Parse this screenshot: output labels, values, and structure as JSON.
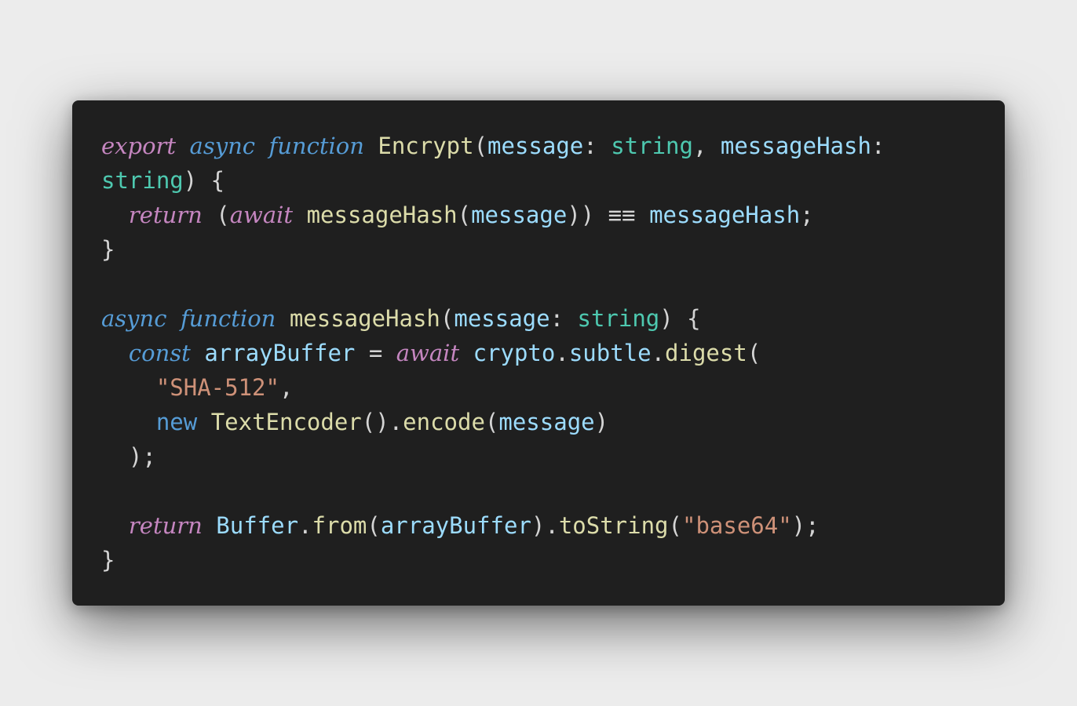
{
  "code_lines": [
    [
      {
        "t": "export",
        "c": "kw-ctrl"
      },
      {
        "t": " ",
        "c": "punc"
      },
      {
        "t": "async",
        "c": "kw-decl"
      },
      {
        "t": " ",
        "c": "punc"
      },
      {
        "t": "function",
        "c": "kw-decl"
      },
      {
        "t": " ",
        "c": "punc"
      },
      {
        "t": "Encrypt",
        "c": "fn"
      },
      {
        "t": "(",
        "c": "punc"
      },
      {
        "t": "message",
        "c": "var"
      },
      {
        "t": ": ",
        "c": "punc"
      },
      {
        "t": "string",
        "c": "type"
      },
      {
        "t": ", ",
        "c": "punc"
      },
      {
        "t": "messageHash",
        "c": "var"
      },
      {
        "t": ":",
        "c": "punc"
      }
    ],
    [
      {
        "t": "string",
        "c": "type"
      },
      {
        "t": ") {",
        "c": "punc"
      }
    ],
    [
      {
        "t": "  ",
        "c": "punc"
      },
      {
        "t": "return",
        "c": "kw-ctrl"
      },
      {
        "t": " (",
        "c": "punc"
      },
      {
        "t": "await",
        "c": "kw-ctrl"
      },
      {
        "t": " ",
        "c": "punc"
      },
      {
        "t": "messageHash",
        "c": "fn"
      },
      {
        "t": "(",
        "c": "punc"
      },
      {
        "t": "message",
        "c": "var"
      },
      {
        "t": ")) ",
        "c": "punc"
      },
      {
        "t": "≡≡",
        "c": "op"
      },
      {
        "t": " ",
        "c": "punc"
      },
      {
        "t": "messageHash",
        "c": "var"
      },
      {
        "t": ";",
        "c": "punc"
      }
    ],
    [
      {
        "t": "}",
        "c": "punc"
      }
    ],
    [],
    [
      {
        "t": "async",
        "c": "kw-decl"
      },
      {
        "t": " ",
        "c": "punc"
      },
      {
        "t": "function",
        "c": "kw-decl"
      },
      {
        "t": " ",
        "c": "punc"
      },
      {
        "t": "messageHash",
        "c": "fn"
      },
      {
        "t": "(",
        "c": "punc"
      },
      {
        "t": "message",
        "c": "var"
      },
      {
        "t": ": ",
        "c": "punc"
      },
      {
        "t": "string",
        "c": "type"
      },
      {
        "t": ") {",
        "c": "punc"
      }
    ],
    [
      {
        "t": "  ",
        "c": "punc"
      },
      {
        "t": "const",
        "c": "kw-decl"
      },
      {
        "t": " ",
        "c": "punc"
      },
      {
        "t": "arrayBuffer",
        "c": "var"
      },
      {
        "t": " = ",
        "c": "punc"
      },
      {
        "t": "await",
        "c": "kw-ctrl"
      },
      {
        "t": " ",
        "c": "punc"
      },
      {
        "t": "crypto",
        "c": "var"
      },
      {
        "t": ".",
        "c": "punc"
      },
      {
        "t": "subtle",
        "c": "var"
      },
      {
        "t": ".",
        "c": "punc"
      },
      {
        "t": "digest",
        "c": "fn"
      },
      {
        "t": "(",
        "c": "punc"
      }
    ],
    [
      {
        "t": "    ",
        "c": "punc"
      },
      {
        "t": "\"SHA-512\"",
        "c": "str"
      },
      {
        "t": ",",
        "c": "punc"
      }
    ],
    [
      {
        "t": "    ",
        "c": "punc"
      },
      {
        "t": "new",
        "c": "kw-new"
      },
      {
        "t": " ",
        "c": "punc"
      },
      {
        "t": "TextEncoder",
        "c": "fn"
      },
      {
        "t": "().",
        "c": "punc"
      },
      {
        "t": "encode",
        "c": "fn"
      },
      {
        "t": "(",
        "c": "punc"
      },
      {
        "t": "message",
        "c": "var"
      },
      {
        "t": ")",
        "c": "punc"
      }
    ],
    [
      {
        "t": "  );",
        "c": "punc"
      }
    ],
    [],
    [
      {
        "t": "  ",
        "c": "punc"
      },
      {
        "t": "return",
        "c": "kw-ctrl"
      },
      {
        "t": " ",
        "c": "punc"
      },
      {
        "t": "Buffer",
        "c": "var"
      },
      {
        "t": ".",
        "c": "punc"
      },
      {
        "t": "from",
        "c": "fn"
      },
      {
        "t": "(",
        "c": "punc"
      },
      {
        "t": "arrayBuffer",
        "c": "var"
      },
      {
        "t": ").",
        "c": "punc"
      },
      {
        "t": "toString",
        "c": "fn"
      },
      {
        "t": "(",
        "c": "punc"
      },
      {
        "t": "\"base64\"",
        "c": "str"
      },
      {
        "t": ");",
        "c": "punc"
      }
    ],
    [
      {
        "t": "}",
        "c": "punc"
      }
    ]
  ],
  "colors": {
    "page_background": "#ececec",
    "editor_background": "#1f1f1f",
    "keyword_control": "#c586c0",
    "keyword_declaration": "#569cd6",
    "function": "#dcdcaa",
    "variable": "#9cdcfe",
    "type": "#4ec9b0",
    "string": "#ce9178",
    "punctuation": "#d4d4d4"
  }
}
